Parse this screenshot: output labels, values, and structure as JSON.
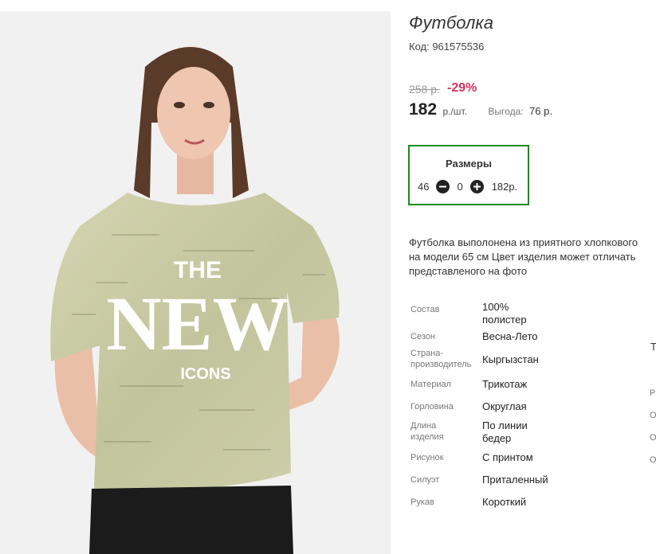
{
  "product": {
    "title": "Футболка",
    "code_text": "Код: 961575536",
    "print_top": "THE",
    "print_main": "NEW",
    "print_bottom": "ICONS"
  },
  "pricing": {
    "old_price": "258 р.",
    "discount": "-29%",
    "price": "182",
    "unit": "р./шт.",
    "benefit_label": "Выгода:",
    "benefit_value": "76 р."
  },
  "sizes": {
    "title": "Размеры",
    "size": "46",
    "quantity": "0",
    "price": "182р."
  },
  "description": {
    "lines": [
      "Футболка выполонена из приятного хлопкового",
      "на модели 65 см Цвет изделия может отличать",
      "представленого на фото"
    ]
  },
  "specs": [
    {
      "label": "Состав",
      "value": "100% полистер"
    },
    {
      "label": "Сезон",
      "value": "Весна-Лето"
    },
    {
      "label": "Страна-производитель",
      "value": "Кыргызстан"
    },
    {
      "label": "Материал",
      "value": "Трикотаж"
    },
    {
      "label": "Горловина",
      "value": "Округлая"
    },
    {
      "label": "Длина изделия",
      "value": "По линии бедер"
    },
    {
      "label": "Рисунок",
      "value": "С принтом"
    },
    {
      "label": "Силуэт",
      "value": "Приталенный"
    },
    {
      "label": "Рукав",
      "value": "Короткий"
    }
  ],
  "side_column": [
    "Т",
    "Р",
    "О",
    "О",
    "О"
  ],
  "colors": {
    "accent_green": "#1e8a1e",
    "discount_red": "#d6335b",
    "shirt": "#c9cba3"
  }
}
